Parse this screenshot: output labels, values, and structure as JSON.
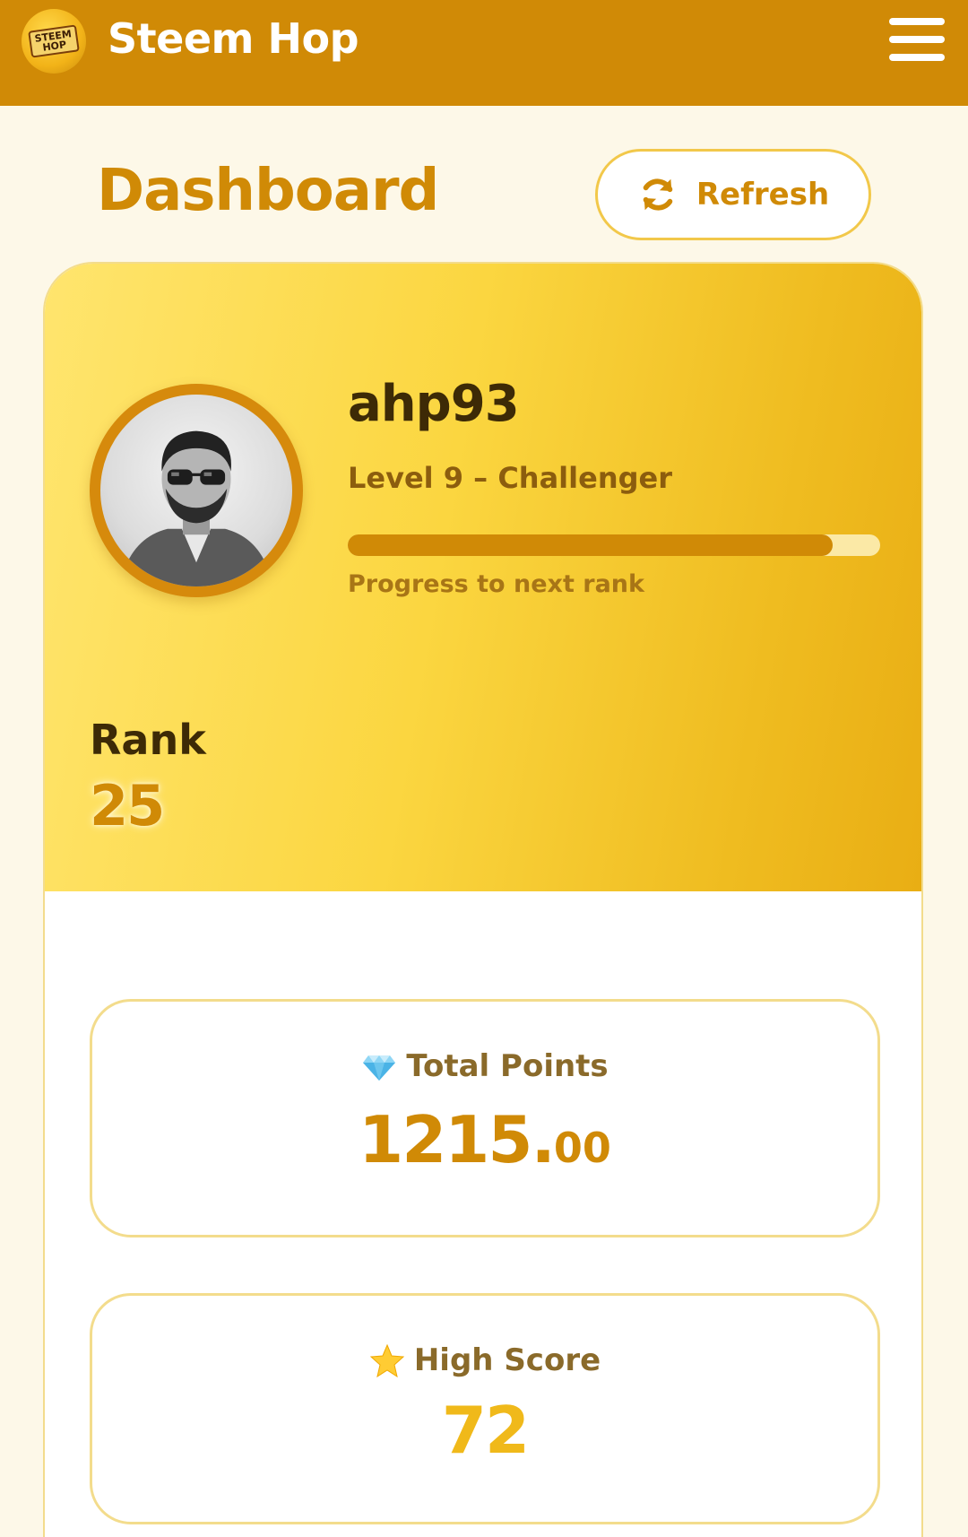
{
  "header": {
    "app_title": "Steem Hop",
    "logo_text_line1": "STEEM",
    "logo_text_line2": "HOP",
    "menu_icon": "hamburger-menu-icon"
  },
  "page": {
    "title": "Dashboard",
    "refresh_label": "Refresh",
    "refresh_icon": "refresh-icon"
  },
  "profile": {
    "username": "ahp93",
    "level_text": "Level 9 – Challenger",
    "progress_fraction": 0.91,
    "progress_label": "Progress to next rank",
    "rank_label": "Rank",
    "rank_value": "25"
  },
  "stats": [
    {
      "icon": "diamond-icon",
      "label": "Total Points",
      "value_int": "1215.",
      "value_dec": "00"
    },
    {
      "icon": "star-icon",
      "label": "High Score",
      "value": "72"
    }
  ],
  "colors": {
    "header_bg": "#d08a06",
    "accent": "#d08a06",
    "page_bg": "#fdf8e8",
    "card_gradient_start": "#ffe56e",
    "card_gradient_end": "#e9ae14",
    "high_score": "#f0b91a"
  }
}
